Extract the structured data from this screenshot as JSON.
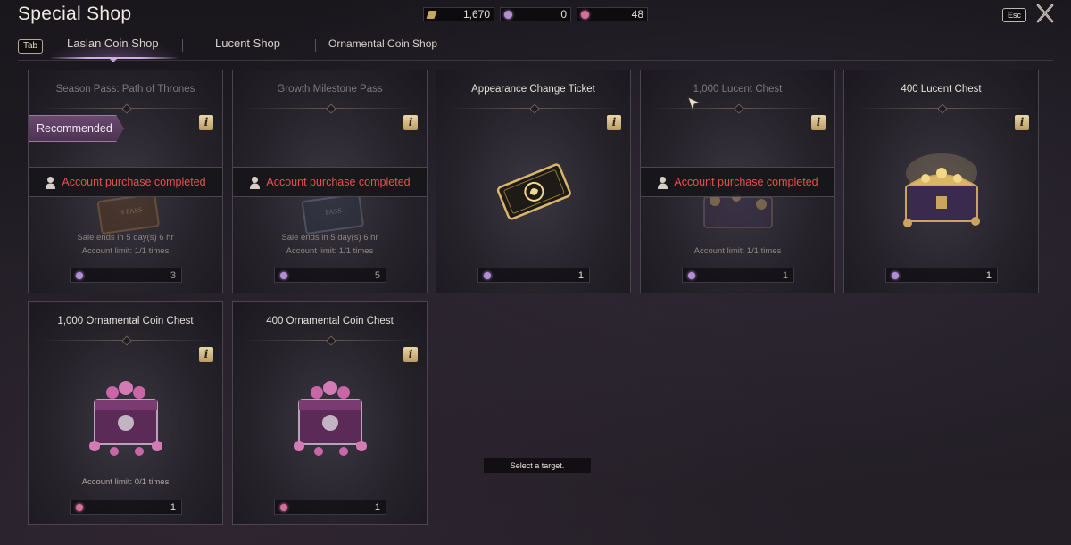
{
  "window": {
    "title": "Special Shop",
    "esc_label": "Esc"
  },
  "currencies": [
    {
      "icon": "laslan-coin-icon",
      "value": "1,670"
    },
    {
      "icon": "lucent-icon",
      "value": "0"
    },
    {
      "icon": "ornamental-coin-icon",
      "value": "48"
    }
  ],
  "tab_key_label": "Tab",
  "tabs": [
    {
      "label": "Laslan Coin Shop",
      "active": true
    },
    {
      "label": "Lucent Shop",
      "active": false
    },
    {
      "label": "Ornamental Coin Shop",
      "active": false
    }
  ],
  "cards": [
    {
      "title": "Season Pass: Path of Thrones",
      "badge": "Recommended",
      "status": "Account purchase completed",
      "sale": "Sale ends in 5 day(s) 6 hr",
      "limit": "Account limit:  1/1 times",
      "price": "3",
      "dim": true
    },
    {
      "title": "Growth Milestone Pass",
      "status": "Account purchase completed",
      "sale": "Sale ends in 5 day(s) 6 hr",
      "limit": "Account limit:  1/1 times",
      "price": "5",
      "dim": true
    },
    {
      "title": "Appearance Change Ticket",
      "price": "1",
      "dim": false
    },
    {
      "title": "1,000 Lucent Chest",
      "status": "Account purchase completed",
      "limit": "Account limit:  1/1 times",
      "price": "1",
      "dim": true
    },
    {
      "title": "400 Lucent Chest",
      "price": "1",
      "dim": false
    },
    {
      "title": "1,000 Ornamental Coin Chest",
      "limit": "Account limit:  0/1 times",
      "price": "1",
      "dim": false
    },
    {
      "title": "400 Ornamental Coin Chest",
      "price": "1",
      "dim": false
    }
  ],
  "tooltip": "Select a target.",
  "colors": {
    "status_red": "#e0544f",
    "accent_purple": "#cfb0e4",
    "gold": "#c9a55f"
  }
}
